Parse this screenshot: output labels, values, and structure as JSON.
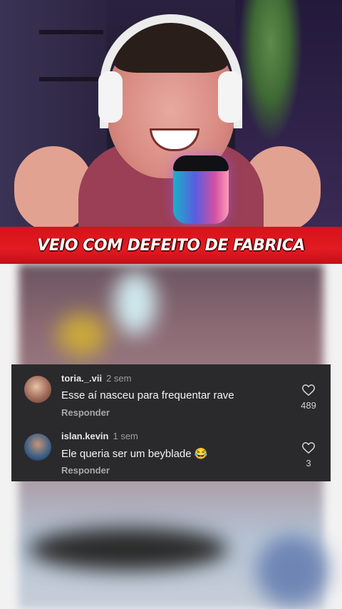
{
  "caption": "VEIO COM DEFEITO DE FABRICA",
  "comments": [
    {
      "username": "toria._.vii",
      "time": "2 sem",
      "text": "Esse aí nasceu para frequentar rave",
      "reply_label": "Responder",
      "likes": "489",
      "avatar_color": "#a06a5a"
    },
    {
      "username": "islan.kevin",
      "time": "1 sem",
      "text": "Ele queria ser um beyblade 😂",
      "reply_label": "Responder",
      "likes": "3",
      "avatar_color": "#3b5f86"
    }
  ],
  "colors": {
    "banner": "#e21b22",
    "card_bg": "#2a2a2c"
  }
}
